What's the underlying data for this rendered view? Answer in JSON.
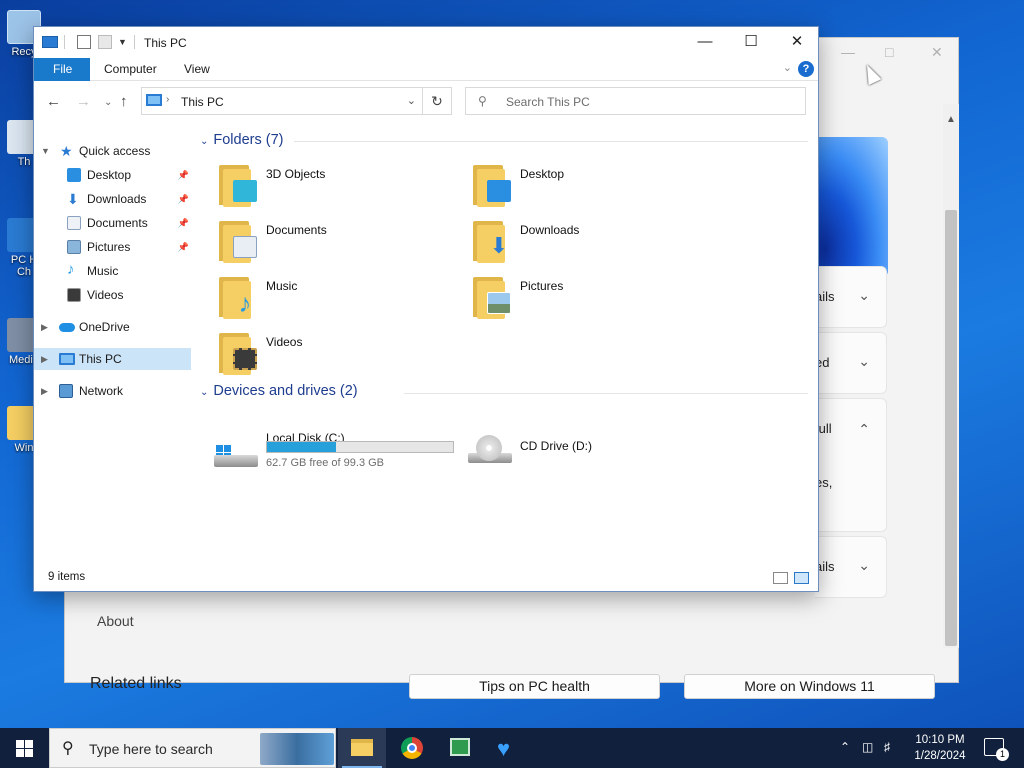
{
  "desktop": {
    "icons": [
      {
        "label": "Recy",
        "color": "#9cc3e8"
      },
      {
        "label": "Th",
        "color": "#dbe6f1"
      },
      {
        "label": "PC H",
        "color": "#2a7bd3"
      },
      {
        "label": "Ch",
        "color": "#2a7bd3"
      },
      {
        "label": "Media",
        "color": "#7f8fa6"
      },
      {
        "label": "Win",
        "color": "#f5cf63"
      }
    ]
  },
  "background_window": {
    "cards": [
      {
        "text": "ails"
      },
      {
        "text": "ed"
      },
      {
        "text": "full"
      },
      {
        "text": "es,"
      },
      {
        "text": "ails"
      }
    ],
    "about": "About",
    "related_links": "Related links",
    "buttons": {
      "tips": "Tips on PC health",
      "more": "More on Windows 11"
    }
  },
  "explorer": {
    "title": "This PC",
    "ribbon_tabs": [
      "File",
      "Computer",
      "View"
    ],
    "help": "?",
    "address": "This PC",
    "search_placeholder": "Search This PC",
    "nav": {
      "quick_access": "Quick access",
      "desktop": "Desktop",
      "downloads": "Downloads",
      "documents": "Documents",
      "pictures": "Pictures",
      "music": "Music",
      "videos": "Videos",
      "onedrive": "OneDrive",
      "this_pc": "This PC",
      "network": "Network"
    },
    "folders_header": "Folders (7)",
    "folders": [
      {
        "name": "3D Objects",
        "badge_color": "#2fb6d8"
      },
      {
        "name": "Desktop",
        "badge_color": "#2a8fe0"
      },
      {
        "name": "Documents",
        "badge_color": "#e9eef5"
      },
      {
        "name": "Downloads",
        "badge_color": "#2a7bd3"
      },
      {
        "name": "Music",
        "badge_color": "#2a9be0"
      },
      {
        "name": "Pictures",
        "badge_color": "#8bb6dc"
      },
      {
        "name": "Videos",
        "badge_color": "#3a3a3a"
      }
    ],
    "devices_header": "Devices and drives (2)",
    "drives": {
      "c": {
        "name": "Local Disk (C:)",
        "free": "62.7 GB free of 99.3 GB",
        "used_fraction": 0.369
      },
      "d": {
        "name": "CD Drive (D:)"
      }
    },
    "status": "9 items"
  },
  "taskbar": {
    "search_placeholder": "Type here to search",
    "time": "10:10 PM",
    "date": "1/28/2024",
    "notification_count": "1",
    "accent": "#7fb6ee"
  }
}
